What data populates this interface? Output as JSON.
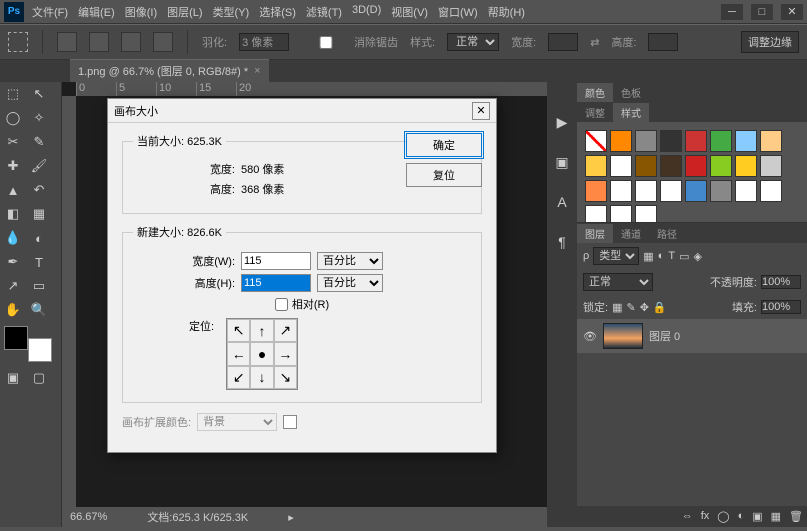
{
  "menu": [
    "文件(F)",
    "编辑(E)",
    "图像(I)",
    "图层(L)",
    "类型(Y)",
    "选择(S)",
    "滤镜(T)",
    "3D(D)",
    "视图(V)",
    "窗口(W)",
    "帮助(H)"
  ],
  "optbar": {
    "feather_label": "羽化:",
    "feather_value": "3 像素",
    "antialias": "消除锯齿",
    "style_label": "样式:",
    "style_value": "正常",
    "width_label": "宽度:",
    "height_label": "高度:",
    "adjust_edges": "调整边缘"
  },
  "doctab": {
    "title": "1.png @ 66.7% (图层 0, RGB/8#) *"
  },
  "ruler_marks": [
    "0",
    "5",
    "10",
    "15",
    "20"
  ],
  "statusbar": {
    "zoom": "66.67%",
    "docinfo": "文档:625.3 K/625.3K"
  },
  "panels": {
    "color_tabs": [
      "颜色",
      "色板"
    ],
    "adjust_tabs": [
      "调整",
      "样式"
    ],
    "layers_tabs": [
      "图层",
      "通道",
      "路径"
    ],
    "kind_label": "类型",
    "blend": "正常",
    "opacity_label": "不透明度:",
    "opacity_val": "100%",
    "lock_label": "锁定:",
    "fill_label": "填充:",
    "fill_val": "100%",
    "layer_name": "图层 0"
  },
  "dialog": {
    "title": "画布大小",
    "current": {
      "label": "当前大小: 625.3K",
      "w_label": "宽度:",
      "w_val": "580 像素",
      "h_label": "高度:",
      "h_val": "368 像素"
    },
    "new": {
      "label": "新建大小: 826.6K",
      "w_label": "宽度(W):",
      "w_val": "115",
      "h_label": "高度(H):",
      "h_val": "115",
      "unit": "百分比",
      "relative": "相对(R)",
      "anchor_label": "定位:"
    },
    "ext_label": "画布扩展颜色:",
    "ext_val": "背景",
    "ok": "确定",
    "reset": "复位"
  },
  "swatches": [
    "#fff",
    "#f80",
    "#888",
    "#333",
    "#c33",
    "#4a4",
    "#8cf",
    "#fc8",
    "#fc4",
    "#fff",
    "#850",
    "#432",
    "#c22",
    "#8c2",
    "#fc2",
    "#ccc",
    "#f84",
    "#fff",
    "#fff",
    "#fff",
    "#48c",
    "#888",
    "#fff",
    "#fff",
    "#fff",
    "#fff",
    "#fff",
    "#fff",
    "#fff",
    "#fff"
  ],
  "chart_data": null
}
